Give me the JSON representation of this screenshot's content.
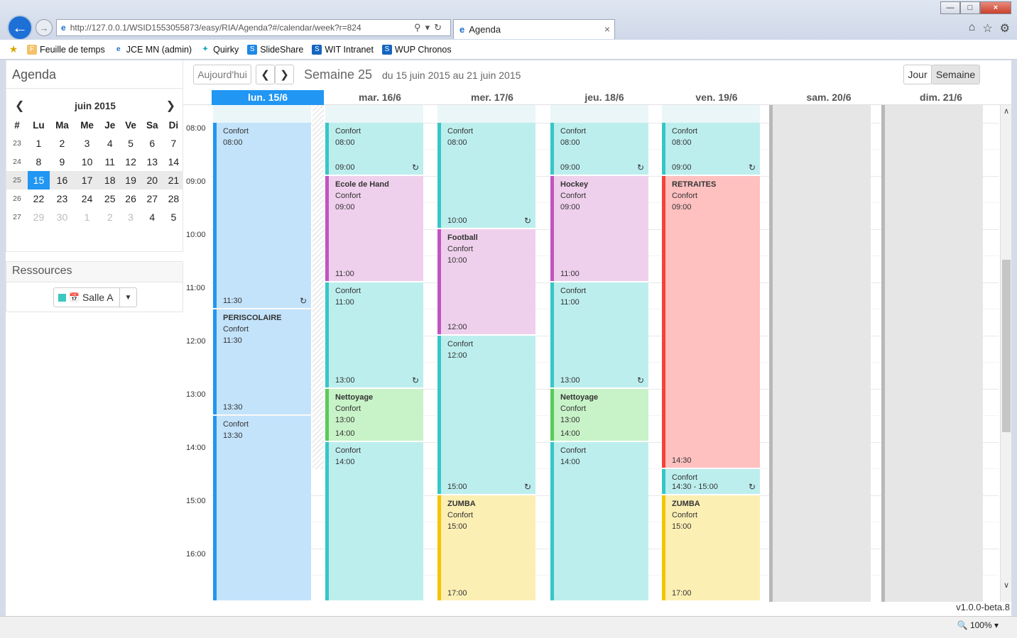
{
  "browser": {
    "address": "http://127.0.0.1/WSID1553055873/easy/RIA/Agenda?#/calendar/week?r=824",
    "tab_title": "Agenda",
    "favorites": [
      "Feuille de temps",
      "JCE MN (admin)",
      "Quirky",
      "SlideShare",
      "WIT Intranet",
      "WUP Chronos"
    ],
    "zoom": "100%"
  },
  "sidebar": {
    "title": "Agenda",
    "month_label": "juin 2015",
    "weekday_headers": [
      "#",
      "Lu",
      "Ma",
      "Me",
      "Je",
      "Ve",
      "Sa",
      "Di"
    ],
    "weeks": [
      {
        "wk": "23",
        "days": [
          "1",
          "2",
          "3",
          "4",
          "5",
          "6",
          "7"
        ],
        "other": []
      },
      {
        "wk": "24",
        "days": [
          "8",
          "9",
          "10",
          "11",
          "12",
          "13",
          "14"
        ],
        "other": []
      },
      {
        "wk": "25",
        "days": [
          "15",
          "16",
          "17",
          "18",
          "19",
          "20",
          "21"
        ],
        "other": []
      },
      {
        "wk": "26",
        "days": [
          "22",
          "23",
          "24",
          "25",
          "26",
          "27",
          "28"
        ],
        "other": []
      },
      {
        "wk": "27",
        "days": [
          "29",
          "30",
          "1",
          "2",
          "3",
          "4",
          "5"
        ],
        "other": [
          2,
          3,
          4,
          5,
          6
        ]
      }
    ],
    "resources_title": "Ressources",
    "resource_label": "Salle A",
    "resource_color": "#3ac8c0"
  },
  "toolbar": {
    "today_label": "Aujourd'hui",
    "week_title": "Semaine 25",
    "week_range": "du 15 juin 2015 au 21 juin 2015",
    "view_day": "Jour",
    "view_week": "Semaine"
  },
  "calendar": {
    "days": [
      "lun. 15/6",
      "mar. 16/6",
      "mer. 17/6",
      "jeu. 18/6",
      "ven. 19/6",
      "sam. 20/6",
      "dim. 21/6"
    ],
    "today_index": 0,
    "hours": [
      "08:00",
      "09:00",
      "10:00",
      "11:00",
      "12:00",
      "13:00",
      "14:00",
      "15:00",
      "16:00"
    ],
    "colors": {
      "blue_bg": "#c3e3fb",
      "blue_bar": "#2196f3",
      "teal_bg": "#bdeeee",
      "teal_bar": "#37c6c6",
      "pink_bg": "#efd0ec",
      "pink_bar": "#c154c1",
      "green_bg": "#c8f2c8",
      "green_bar": "#5bc95b",
      "red_bg": "#ffc0c0",
      "red_bar": "#f44336",
      "yellow_bg": "#fcefb4",
      "yellow_bar": "#f5c400"
    },
    "events": [
      {
        "day": 0,
        "start": "08:00",
        "end": "11:30",
        "title": "",
        "room": "Confort",
        "start_label": "08:00",
        "end_label": "11:30",
        "color": "blue",
        "recurring": true
      },
      {
        "day": 0,
        "start": "11:30",
        "end": "13:30",
        "title": "PERISCOLAIRE",
        "room": "Confort",
        "start_label": "11:30",
        "end_label": "13:30",
        "color": "blue",
        "recurring": false
      },
      {
        "day": 0,
        "start": "13:30",
        "end": "17:00",
        "title": "",
        "room": "Confort",
        "start_label": "13:30",
        "end_label": "",
        "color": "blue",
        "recurring": false
      },
      {
        "day": 1,
        "start": "08:00",
        "end": "09:00",
        "title": "",
        "room": "Confort",
        "start_label": "08:00",
        "end_label": "09:00",
        "color": "teal",
        "recurring": true
      },
      {
        "day": 1,
        "start": "09:00",
        "end": "11:00",
        "title": "Ecole de Hand",
        "room": "Confort",
        "start_label": "09:00",
        "end_label": "11:00",
        "color": "pink",
        "recurring": false
      },
      {
        "day": 1,
        "start": "11:00",
        "end": "13:00",
        "title": "",
        "room": "Confort",
        "start_label": "11:00",
        "end_label": "13:00",
        "color": "teal",
        "recurring": true
      },
      {
        "day": 1,
        "start": "13:00",
        "end": "14:00",
        "title": "Nettoyage",
        "room": "Confort",
        "start_label": "13:00",
        "end_label": "14:00",
        "color": "green",
        "recurring": false
      },
      {
        "day": 1,
        "start": "14:00",
        "end": "17:00",
        "title": "",
        "room": "Confort",
        "start_label": "14:00",
        "end_label": "",
        "color": "teal",
        "recurring": false
      },
      {
        "day": 2,
        "start": "08:00",
        "end": "10:00",
        "title": "",
        "room": "Confort",
        "start_label": "08:00",
        "end_label": "10:00",
        "color": "teal",
        "recurring": true
      },
      {
        "day": 2,
        "start": "10:00",
        "end": "12:00",
        "title": "Football",
        "room": "Confort",
        "start_label": "10:00",
        "end_label": "12:00",
        "color": "pink",
        "recurring": false
      },
      {
        "day": 2,
        "start": "12:00",
        "end": "15:00",
        "title": "",
        "room": "Confort",
        "start_label": "12:00",
        "end_label": "15:00",
        "color": "teal",
        "recurring": true
      },
      {
        "day": 2,
        "start": "15:00",
        "end": "17:00",
        "title": "ZUMBA",
        "room": "Confort",
        "start_label": "15:00",
        "end_label": "17:00",
        "color": "yellow",
        "recurring": false
      },
      {
        "day": 3,
        "start": "08:00",
        "end": "09:00",
        "title": "",
        "room": "Confort",
        "start_label": "08:00",
        "end_label": "09:00",
        "color": "teal",
        "recurring": true
      },
      {
        "day": 3,
        "start": "09:00",
        "end": "11:00",
        "title": "Hockey",
        "room": "Confort",
        "start_label": "09:00",
        "end_label": "11:00",
        "color": "pink",
        "recurring": false
      },
      {
        "day": 3,
        "start": "11:00",
        "end": "13:00",
        "title": "",
        "room": "Confort",
        "start_label": "11:00",
        "end_label": "13:00",
        "color": "teal",
        "recurring": true
      },
      {
        "day": 3,
        "start": "13:00",
        "end": "14:00",
        "title": "Nettoyage",
        "room": "Confort",
        "start_label": "13:00",
        "end_label": "14:00",
        "color": "green",
        "recurring": false
      },
      {
        "day": 3,
        "start": "14:00",
        "end": "17:00",
        "title": "",
        "room": "Confort",
        "start_label": "14:00",
        "end_label": "",
        "color": "teal",
        "recurring": false
      },
      {
        "day": 4,
        "start": "08:00",
        "end": "09:00",
        "title": "",
        "room": "Confort",
        "start_label": "08:00",
        "end_label": "09:00",
        "color": "teal",
        "recurring": true
      },
      {
        "day": 4,
        "start": "09:00",
        "end": "14:30",
        "title": "RETRAITES",
        "room": "Confort",
        "start_label": "09:00",
        "end_label": "14:30",
        "color": "red",
        "recurring": false
      },
      {
        "day": 4,
        "start": "14:30",
        "end": "15:00",
        "title": "",
        "room": "Confort",
        "start_label": "",
        "end_label": "14:30 - 15:00",
        "color": "teal",
        "recurring": true
      },
      {
        "day": 4,
        "start": "15:00",
        "end": "17:00",
        "title": "ZUMBA",
        "room": "Confort",
        "start_label": "15:00",
        "end_label": "17:00",
        "color": "yellow",
        "recurring": false
      }
    ]
  },
  "footer": {
    "version": "v1.0.0-beta.8"
  }
}
